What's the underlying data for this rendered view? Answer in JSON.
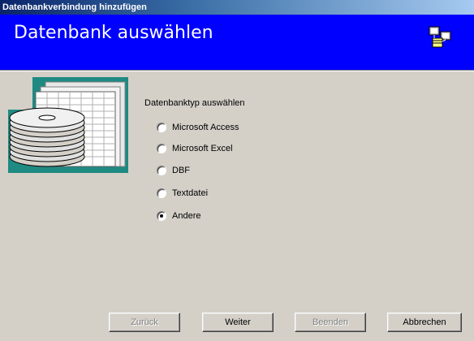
{
  "window": {
    "title": "Datenbankverbindung hinzufügen"
  },
  "banner": {
    "title": "Datenbank auswählen",
    "icon": "database-network-icon"
  },
  "side_image": {
    "icon": "database-stack-icon"
  },
  "group": {
    "label": "Datenbanktyp auswählen",
    "options": [
      {
        "label": "Microsoft Access",
        "selected": false
      },
      {
        "label": "Microsoft Excel",
        "selected": false
      },
      {
        "label": "DBF",
        "selected": false
      },
      {
        "label": "Textdatei",
        "selected": false
      },
      {
        "label": "Andere",
        "selected": true
      }
    ]
  },
  "buttons": {
    "back": {
      "label": "Zurück",
      "enabled": false
    },
    "next": {
      "label": "Weiter",
      "enabled": true
    },
    "finish": {
      "label": "Beenden",
      "enabled": false
    },
    "cancel": {
      "label": "Abbrechen",
      "enabled": true
    }
  },
  "colors": {
    "banner": "#0000ff",
    "window": "#d4d0c8",
    "side_background": "#1e8a82"
  }
}
